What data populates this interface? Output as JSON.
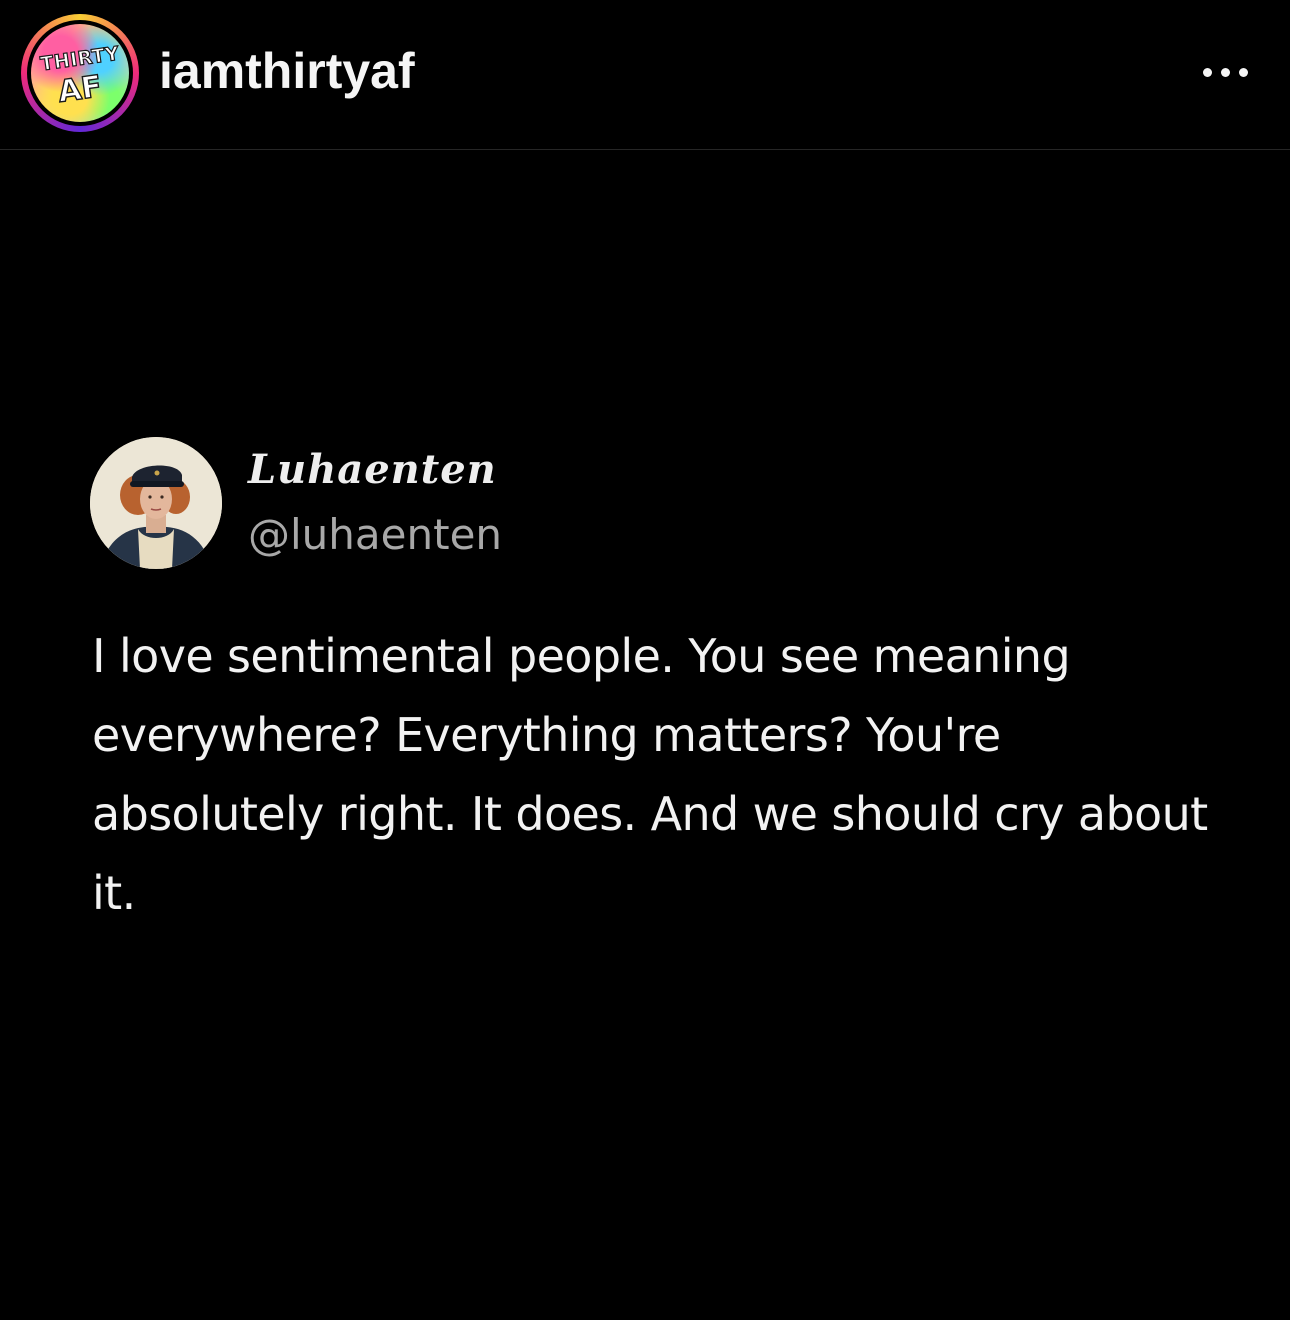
{
  "post": {
    "author": {
      "username": "iamthirtyaf",
      "logo_text_top": "THIRTY",
      "logo_text_bottom": "AF"
    },
    "menu_icon": "more-horizontal-icon"
  },
  "tweet": {
    "display_name": "Luhaenten",
    "handle": "@luhaenten",
    "text": "I love sentimental people. You see meaning everywhere? Everything matters? You're absolutely right. It does. And we should cry about it."
  },
  "colors": {
    "background": "#000000",
    "text_primary": "#f5f5f5",
    "text_secondary": "#a8a8a8",
    "divider": "#262626"
  }
}
